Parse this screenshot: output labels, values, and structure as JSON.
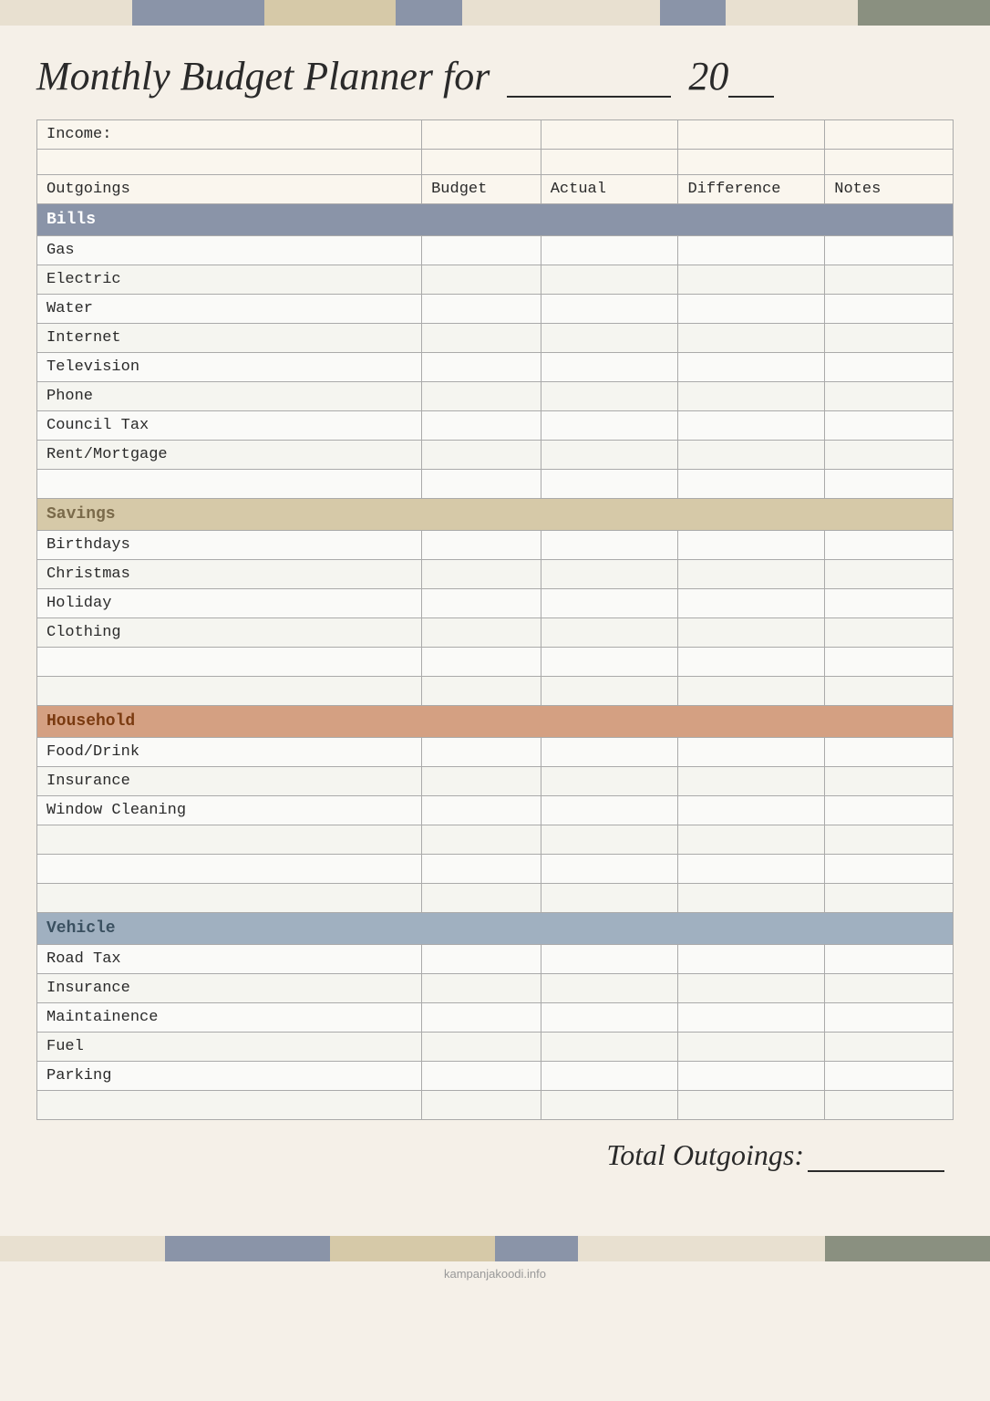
{
  "topbar": {
    "segments": [
      {
        "color": "#e8e0d0",
        "flex": 2
      },
      {
        "color": "#8a94a8",
        "flex": 2
      },
      {
        "color": "#d6c9a8",
        "flex": 2
      },
      {
        "color": "#8a94a8",
        "flex": 1
      },
      {
        "color": "#e8e0d0",
        "flex": 3
      },
      {
        "color": "#8a94a8",
        "flex": 1
      },
      {
        "color": "#e8e0d0",
        "flex": 2
      },
      {
        "color": "#8a9080",
        "flex": 2
      }
    ]
  },
  "title": "Monthly Budget Planner for",
  "title_year": "20",
  "table": {
    "income_label": "Income:",
    "columns": {
      "outgoings": "Outgoings",
      "budget": "Budget",
      "actual": "Actual",
      "difference": "Difference",
      "notes": "Notes"
    },
    "sections": [
      {
        "id": "bills",
        "header": "Bills",
        "color": "bills-header",
        "items": [
          "Gas",
          "Electric",
          "Water",
          "Internet",
          "Television",
          "Phone",
          "Council Tax",
          "Rent/Mortgage",
          ""
        ]
      },
      {
        "id": "savings",
        "header": "Savings",
        "color": "savings-header",
        "items": [
          "Birthdays",
          "Christmas",
          "Holiday",
          "Clothing",
          "",
          ""
        ]
      },
      {
        "id": "household",
        "header": "Household",
        "color": "household-header",
        "items": [
          "Food/Drink",
          "Insurance",
          "Window Cleaning",
          "",
          "",
          ""
        ]
      },
      {
        "id": "vehicle",
        "header": "Vehicle",
        "color": "vehicle-header",
        "items": [
          "Road Tax",
          "Insurance",
          "Maintainence",
          "Fuel",
          "Parking",
          ""
        ]
      }
    ]
  },
  "total_outgoings_label": "Total Outgoings:",
  "bottombar": {
    "segments": [
      {
        "color": "#e8e0d0",
        "flex": 2
      },
      {
        "color": "#8a94a8",
        "flex": 2
      },
      {
        "color": "#d6c9a8",
        "flex": 2
      },
      {
        "color": "#8a94a8",
        "flex": 1
      },
      {
        "color": "#e8e0d0",
        "flex": 3
      },
      {
        "color": "#8a9080",
        "flex": 2
      }
    ]
  },
  "watermark": "kampanjakoodi.info"
}
